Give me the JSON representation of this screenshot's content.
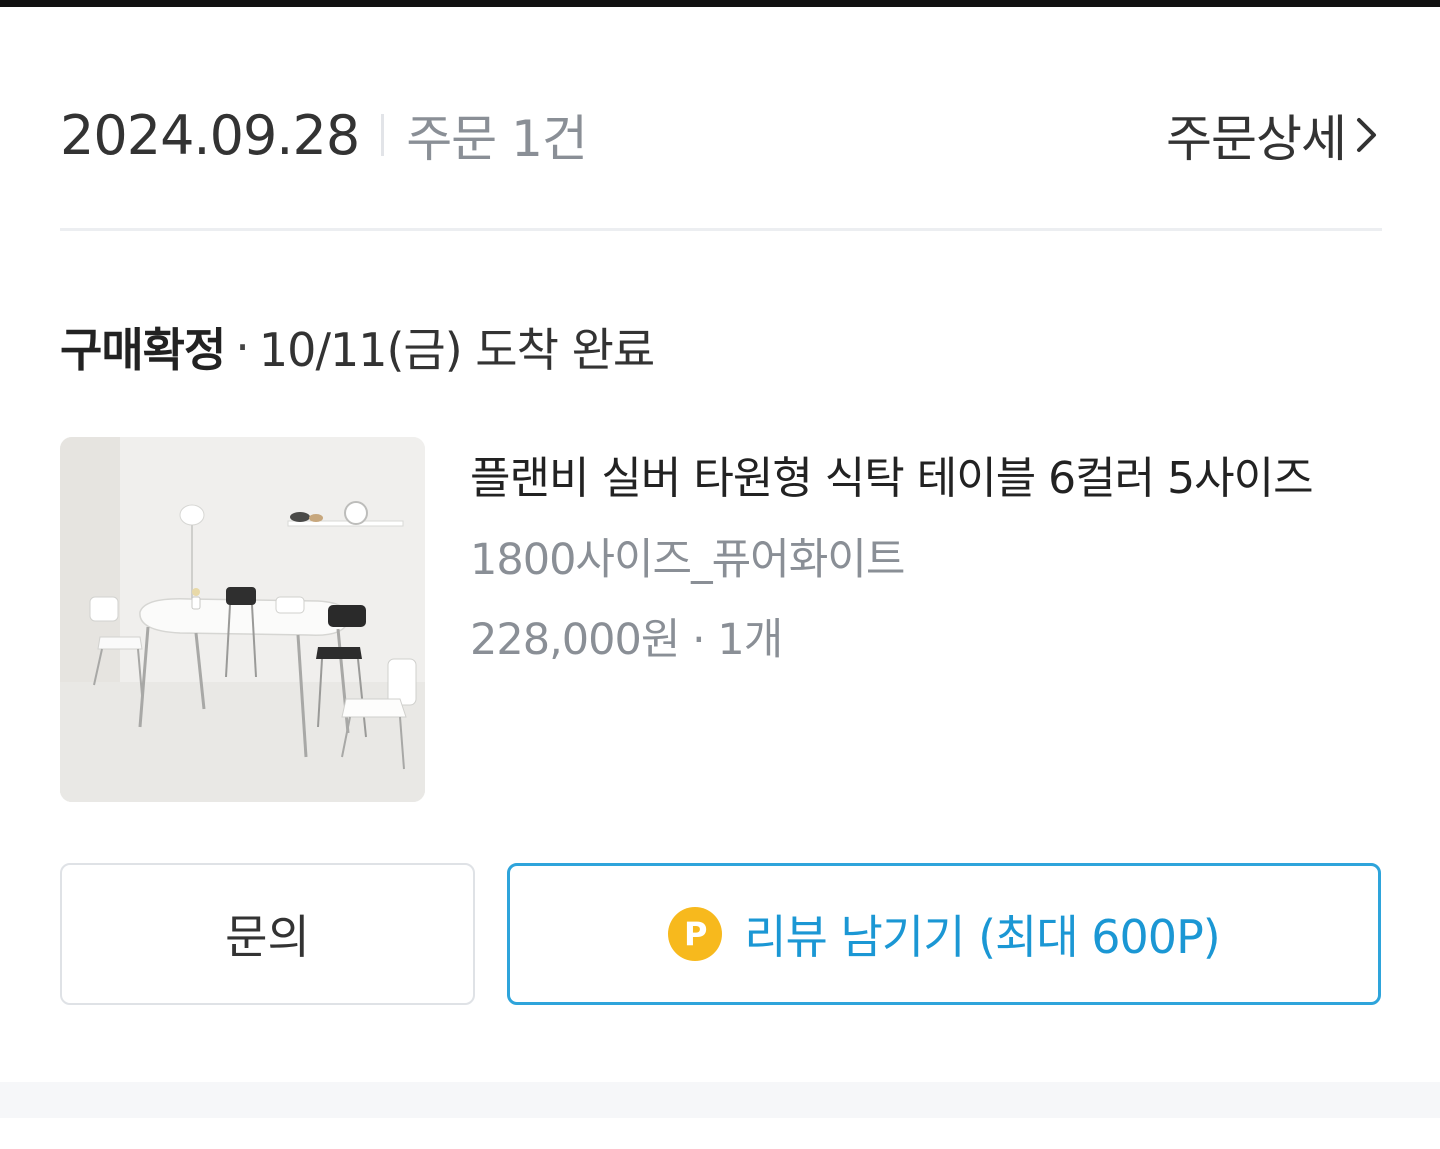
{
  "order": {
    "date": "2024.09.28",
    "count_label": "주문 1건",
    "detail_label": "주문상세"
  },
  "status": {
    "state": "구매확정",
    "separator": "·",
    "arrival": "10/11(금) 도착 완료"
  },
  "product": {
    "name": "플랜비 실버 타원형 식탁 테이블 6컬러 5사이즈",
    "option": "1800사이즈_퓨어화이트",
    "price_qty": "228,000원 · 1개"
  },
  "actions": {
    "inquiry_label": "문의",
    "review_badge": "P",
    "review_label": "리뷰 남기기 (최대 600P)"
  },
  "colors": {
    "accent": "#2ea4db",
    "point_badge": "#f7b91d"
  }
}
